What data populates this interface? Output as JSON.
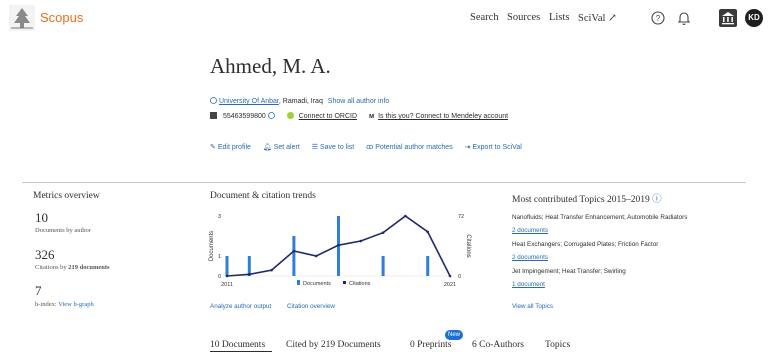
{
  "header": {
    "brand": "Scopus",
    "nav": [
      "Search",
      "Sources",
      "Lists",
      "SciVal ↗"
    ],
    "avatar_initials": "KD"
  },
  "author": {
    "name": "Ahmed, M. A.",
    "affiliation": "University Of Anbar",
    "location": ", Ramadi, Iraq",
    "show_all_info": "Show all author info",
    "author_id": "55463599800",
    "connect_orcid": "Connect to ORCID",
    "mendeley_prompt": "Is this you? Connect to Mendeley account"
  },
  "actions": [
    "Edit profile",
    "Set alert",
    "Save to list",
    "Potential author matches",
    "Export to SciVal"
  ],
  "metrics": {
    "title": "Metrics overview",
    "documents_value": "10",
    "documents_label": "Documents by author",
    "citations_value": "326",
    "citations_label_prefix": "Citations by ",
    "citations_label_bold": "219 documents",
    "hindex_value": "7",
    "hindex_label": "h-index:",
    "view_hgraph": "View h-graph"
  },
  "trends": {
    "title": "Document & citation trends",
    "analyze_link": "Analyze author output",
    "citation_overview_link": "Citation overview"
  },
  "chart_data": {
    "type": "bar",
    "x": [
      2011,
      2012,
      2013,
      2014,
      2015,
      2016,
      2017,
      2018,
      2019,
      2020,
      2021
    ],
    "x_tick_labels": [
      "2011",
      "2021"
    ],
    "ylabel": "Documents",
    "y2label": "Citations",
    "ylim": [
      0,
      3
    ],
    "y_ticks": [
      "3",
      "1",
      "0"
    ],
    "y2lim": [
      0,
      72
    ],
    "y2_ticks": [
      "72",
      "0"
    ],
    "series": [
      {
        "name": "Documents",
        "type": "bar",
        "color": "#2f7fd9",
        "values": [
          1,
          1,
          0,
          2,
          0,
          3,
          0,
          1,
          0,
          1,
          0
        ]
      },
      {
        "name": "Citations",
        "type": "line",
        "color": "#1f2a6b",
        "values": [
          0,
          2,
          7,
          30,
          24,
          37,
          42,
          52,
          72,
          53,
          0
        ]
      }
    ],
    "legend": "bottom"
  },
  "topics": {
    "title": "Most contributed Topics 2015–2019",
    "items": [
      {
        "name": "Nanofluids; Heat Transfer Enhancement; Automobile Radiators",
        "docs": "2 documents"
      },
      {
        "name": "Heat Exchangers; Corrugated Plates; Friction Factor",
        "docs": "2 documents"
      },
      {
        "name": "Jet Impingement; Heat Transfer; Swirling",
        "docs": "1 document"
      }
    ],
    "view_all": "View all Topics"
  },
  "tabs": [
    {
      "label": "10 Documents",
      "active": true
    },
    {
      "label": "Cited by 219 Documents"
    },
    {
      "label": "0 Preprints"
    },
    {
      "label": "6 Co-Authors"
    },
    {
      "label": "Topics"
    }
  ],
  "new_badge": "New",
  "colors": {
    "brand": "#e9711c",
    "link": "#2b6cb0",
    "bar": "#2f7fd9",
    "line": "#1f2a6b"
  }
}
